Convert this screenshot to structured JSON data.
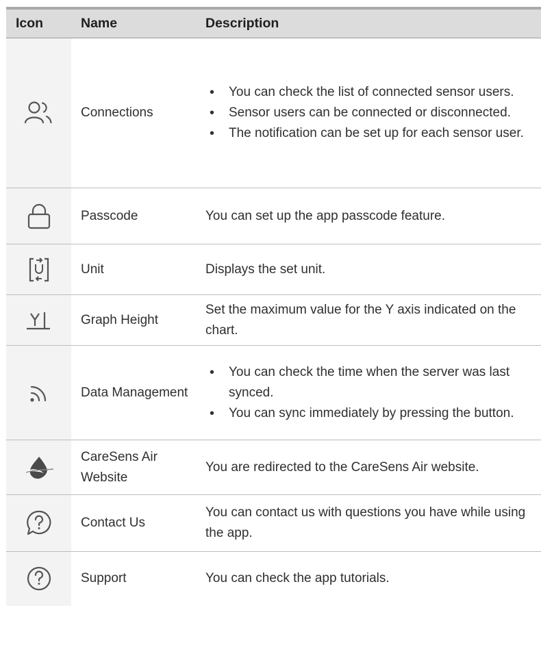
{
  "table": {
    "headers": {
      "icon": "Icon",
      "name": "Name",
      "description": "Description"
    },
    "rows": [
      {
        "icon": "users-icon",
        "name": "Connections",
        "bullets": [
          "You can check the list of connected sensor users.",
          "Sensor users can be connected or disconnected.",
          "The notification can be set up for each sensor user."
        ]
      },
      {
        "icon": "lock-icon",
        "name": "Passcode",
        "description": "You can set up the app passcode feature."
      },
      {
        "icon": "unit-icon",
        "name": "Unit",
        "description": "Displays the set unit."
      },
      {
        "icon": "graph-height-icon",
        "name": "Graph Height",
        "description": "Set the maximum value for the Y axis indicated on the chart."
      },
      {
        "icon": "sync-signal-icon",
        "name": "Data Management",
        "bullets": [
          "You can check the time when the server was last synced.",
          "You can sync immediately by pressing the button."
        ]
      },
      {
        "icon": "caresens-logo-icon",
        "name": "CareSens Air Website",
        "description": "You are redirected to the CareSens Air website."
      },
      {
        "icon": "chat-question-icon",
        "name": "Contact Us",
        "description": "You can contact us with questions you have while using the app."
      },
      {
        "icon": "help-circle-icon",
        "name": "Support",
        "description": "You can check the app tutorials."
      }
    ]
  }
}
